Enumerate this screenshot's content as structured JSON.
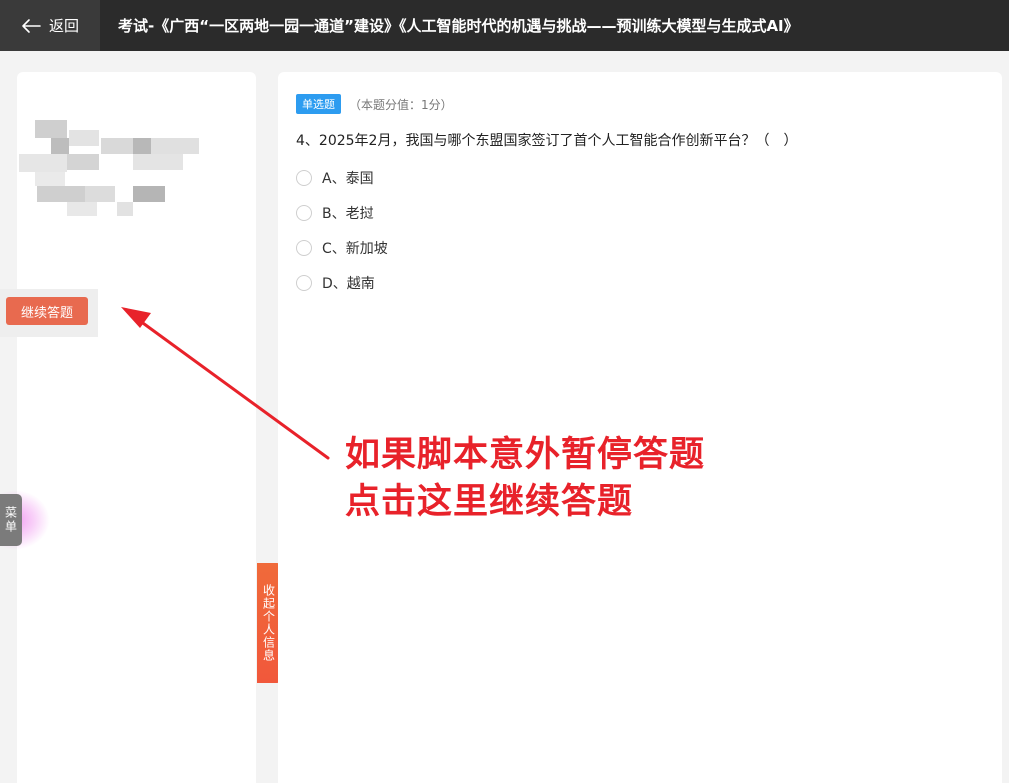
{
  "header": {
    "back_label": "返回",
    "title": "考试-《广西“一区两地一园一通道”建设》《人工智能时代的机遇与挑战——预训练大模型与生成式AI》"
  },
  "left": {
    "continue_label": "继续答题",
    "menu_label": "菜单",
    "collapse_label": "收起个人信息"
  },
  "question": {
    "type_label": "单选题",
    "score_label": "（本题分值：1分）",
    "text": "4、2025年2月，我国与哪个东盟国家签订了首个人工智能合作创新平台？（　）",
    "options": [
      {
        "label": "A、泰国"
      },
      {
        "label": "B、老挝"
      },
      {
        "label": "C、新加坡"
      },
      {
        "label": "D、越南"
      }
    ]
  },
  "annotation": {
    "line1": "如果脚本意外暂停答题",
    "line2": "点击这里继续答题",
    "color": "#e8222a"
  },
  "colors": {
    "header_bg": "#2b2b2b",
    "accent_blue": "#2d9cf0",
    "continue_btn": "#e86a4f",
    "collapse_tab": "#f1583b"
  }
}
